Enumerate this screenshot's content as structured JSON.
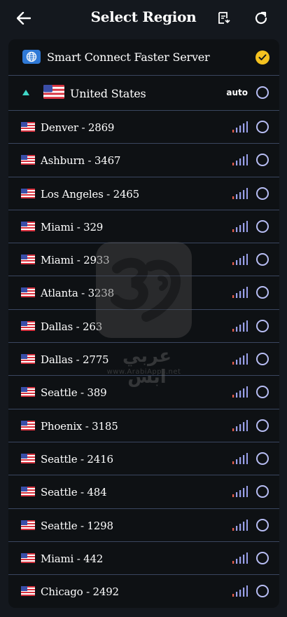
{
  "header": {
    "title": "Select Region",
    "back_icon": "arrow-left-icon",
    "list_icon": "document-list-icon",
    "refresh_icon": "refresh-icon"
  },
  "smart_connect": {
    "label": "Smart Connect Faster Server",
    "icon": "globe-icon",
    "selected": true
  },
  "country": {
    "name": "United States",
    "mode": "auto",
    "expanded": true
  },
  "servers": [
    {
      "label": "Denver - 2869"
    },
    {
      "label": "Ashburn - 3467"
    },
    {
      "label": "Los Angeles - 2465"
    },
    {
      "label": "Miami - 329"
    },
    {
      "label": "Miami - 2933"
    },
    {
      "label": "Atlanta - 3238"
    },
    {
      "label": "Dallas - 263"
    },
    {
      "label": "Dallas - 2775"
    },
    {
      "label": "Seattle - 389"
    },
    {
      "label": "Phoenix - 3185"
    },
    {
      "label": "Seattle - 2416"
    },
    {
      "label": "Seattle - 484"
    },
    {
      "label": "Seattle - 1298"
    },
    {
      "label": "Miami - 442"
    },
    {
      "label": "Chicago - 2492"
    }
  ],
  "watermark": {
    "text": "عربي ابس",
    "url": "www.ArabiApps.net"
  },
  "colors": {
    "background": "#14181e",
    "card": "#0e1114",
    "divider": "#3a4660",
    "accent_radio": "#b7bdf3",
    "check": "#f4c220",
    "signal_low": "#e8604f",
    "signal_bars": "#9aa0ea"
  }
}
